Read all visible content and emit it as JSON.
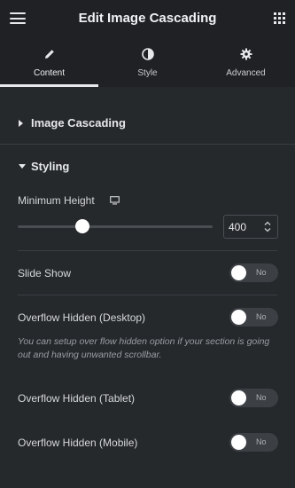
{
  "header": {
    "title": "Edit Image Cascading",
    "menu_icon": "hamburger-icon",
    "apps_icon": "grid-icon"
  },
  "tabs": [
    {
      "label": "Content",
      "icon": "pencil-icon",
      "active": true
    },
    {
      "label": "Style",
      "icon": "half-circle-icon",
      "active": false
    },
    {
      "label": "Advanced",
      "icon": "gear-icon",
      "active": false
    }
  ],
  "sections": {
    "image_cascading": {
      "label": "Image Cascading",
      "expanded": false
    },
    "styling": {
      "label": "Styling",
      "expanded": true
    }
  },
  "controls": {
    "min_height": {
      "label": "Minimum Height",
      "device_icon": "desktop-monitor-icon",
      "value": "400",
      "slider_fraction": 0.33
    },
    "slide_show": {
      "label": "Slide Show",
      "toggle": "No"
    },
    "overflow_desktop": {
      "label": "Overflow Hidden (Desktop)",
      "toggle": "No",
      "description": "You can setup over flow hidden option if your section is going out and having unwanted scrollbar."
    },
    "overflow_tablet": {
      "label": "Overflow Hidden (Tablet)",
      "toggle": "No"
    },
    "overflow_mobile": {
      "label": "Overflow Hidden (Mobile)",
      "toggle": "No"
    }
  },
  "colors": {
    "panel_bg": "#26292c",
    "header_bg": "#1f2124",
    "toggle_bg": "#3c4045"
  }
}
